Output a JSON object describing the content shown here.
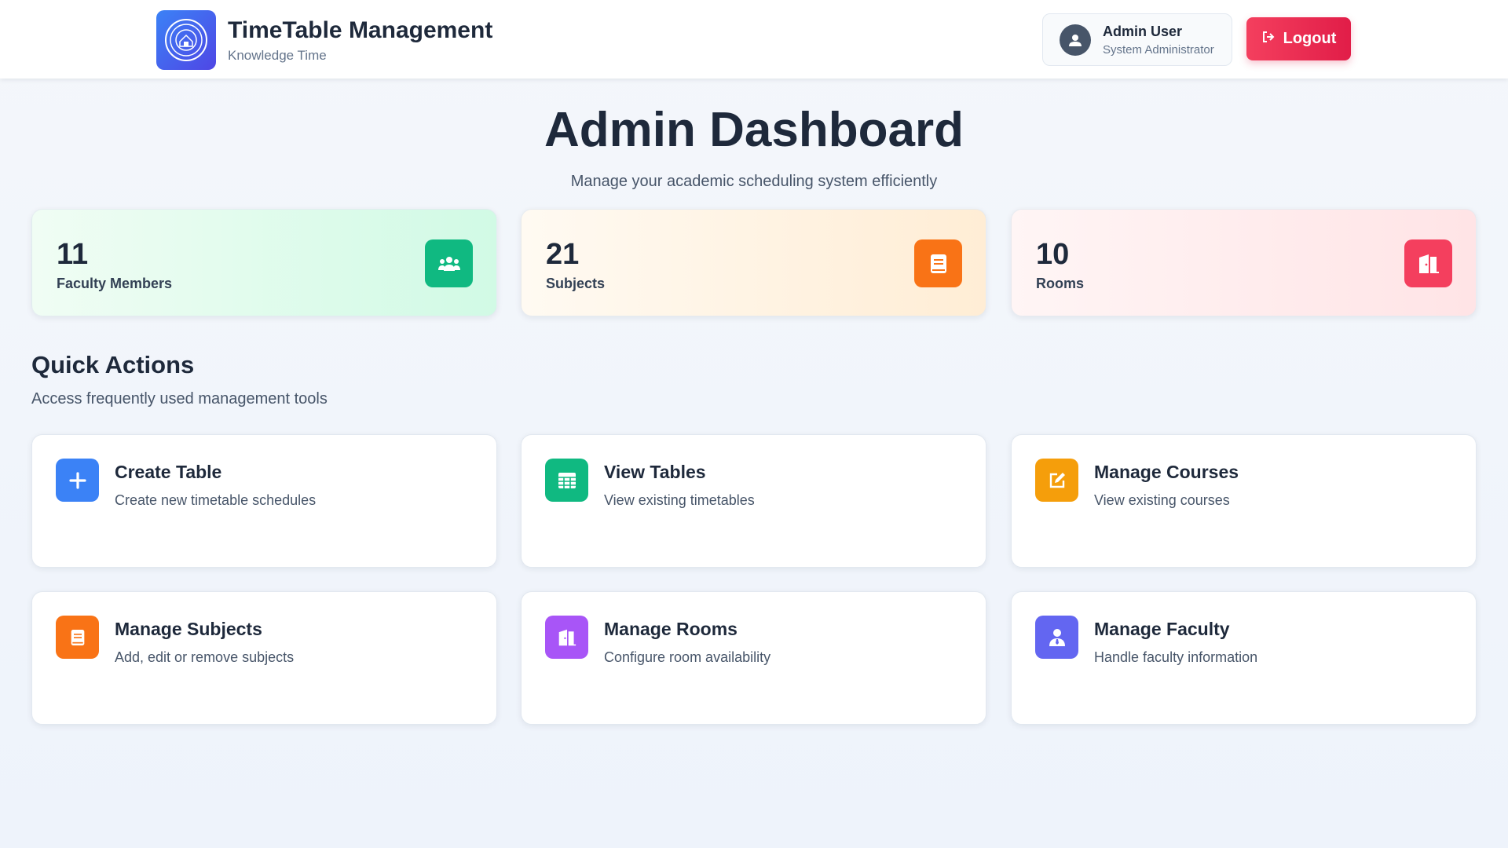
{
  "header": {
    "app_title": "TimeTable Management",
    "app_subtitle": "Knowledge Time",
    "logo_icon": "university-seal-icon",
    "user_name": "Admin User",
    "user_role": "System Administrator",
    "logout_label": "Logout"
  },
  "page": {
    "title": "Admin Dashboard",
    "subtitle": "Manage your academic scheduling system efficiently"
  },
  "stats": [
    {
      "value": "11",
      "label": "Faculty Members",
      "icon": "users-icon",
      "accent": "#10b981"
    },
    {
      "value": "21",
      "label": "Subjects",
      "icon": "book-icon",
      "accent": "#f97316"
    },
    {
      "value": "10",
      "label": "Rooms",
      "icon": "door-icon",
      "accent": "#f43f5e"
    }
  ],
  "quick_actions": {
    "title": "Quick Actions",
    "subtitle": "Access frequently used management tools",
    "items": [
      {
        "title": "Create Table",
        "desc": "Create new timetable schedules",
        "icon": "plus-icon",
        "color": "#3b82f6"
      },
      {
        "title": "View Tables",
        "desc": "View existing timetables",
        "icon": "table-icon",
        "color": "#10b981"
      },
      {
        "title": "Manage Courses",
        "desc": "View existing courses",
        "icon": "edit-icon",
        "color": "#f59e0b"
      },
      {
        "title": "Manage Subjects",
        "desc": "Add, edit or remove subjects",
        "icon": "book-icon",
        "color": "#f97316"
      },
      {
        "title": "Manage Rooms",
        "desc": "Configure room availability",
        "icon": "door-icon",
        "color": "#a855f7"
      },
      {
        "title": "Manage Faculty",
        "desc": "Handle faculty information",
        "icon": "user-tie-icon",
        "color": "#6366f1"
      }
    ]
  }
}
